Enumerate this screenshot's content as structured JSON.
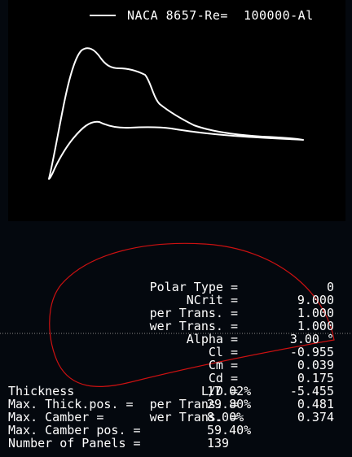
{
  "legend": {
    "label": "NACA 8657-Re=  100000-Al"
  },
  "params": [
    {
      "label": "Polar Type =",
      "value": "0"
    },
    {
      "label": "NCrit =",
      "value": "9.000"
    },
    {
      "label": "per Trans. =",
      "value": "1.000"
    },
    {
      "label": "wer Trans. =",
      "value": "1.000"
    },
    {
      "label": "Alpha =",
      "value": "3.00 °"
    },
    {
      "label": "Cl =",
      "value": "-0.955"
    },
    {
      "label": "Cm =",
      "value": "0.039"
    },
    {
      "label": "Cd =",
      "value": "0.175"
    },
    {
      "label": "L/D =",
      "value": "-5.455"
    },
    {
      "label": "per Trans. =",
      "value": "0.481"
    },
    {
      "label": "wer Trans. =",
      "value": "0.374"
    }
  ],
  "foil": [
    {
      "label": "Thickness",
      "value": "17.02%"
    },
    {
      "label": "Max. Thick.pos. =",
      "value": "29.80%"
    },
    {
      "label": "Max. Camber =",
      "value": "8.00%"
    },
    {
      "label": "Max. Camber pos. =",
      "value": "59.40%"
    },
    {
      "label": "Number of Panels =",
      "value": "139"
    }
  ],
  "colors": {
    "background": "#04080e",
    "plot": "#000000",
    "curve": "#ffffff",
    "airfoil": "#cc1111"
  }
}
